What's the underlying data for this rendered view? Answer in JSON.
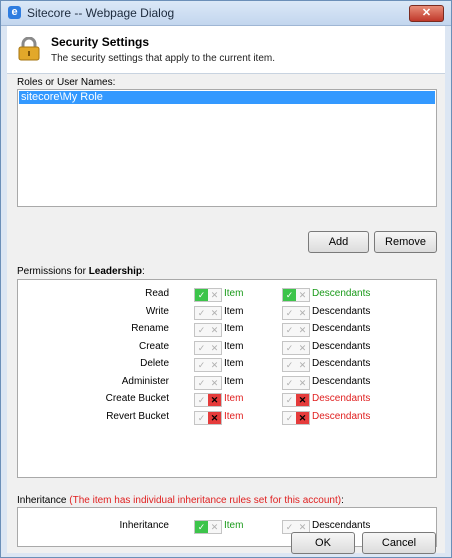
{
  "window": {
    "title": "Sitecore -- Webpage Dialog",
    "close_label": "✕"
  },
  "header": {
    "title": "Security Settings",
    "subtitle": "The security settings that apply to the current item."
  },
  "roles": {
    "label": "Roles or User Names:",
    "items": [
      "sitecore\\My Role"
    ],
    "add_label": "Add",
    "remove_label": "Remove"
  },
  "permissions": {
    "label_prefix": "Permissions for ",
    "target": "Leadership",
    "label_suffix": ":",
    "item_label": "Item",
    "descendants_label": "Descendants",
    "rows": [
      {
        "name": "Read",
        "item": "allow",
        "descendants": "allow"
      },
      {
        "name": "Write",
        "item": "none",
        "descendants": "none"
      },
      {
        "name": "Rename",
        "item": "none",
        "descendants": "none"
      },
      {
        "name": "Create",
        "item": "none",
        "descendants": "none"
      },
      {
        "name": "Delete",
        "item": "none",
        "descendants": "none"
      },
      {
        "name": "Administer",
        "item": "none",
        "descendants": "none"
      },
      {
        "name": "Create Bucket",
        "item": "deny",
        "descendants": "deny"
      },
      {
        "name": "Revert Bucket",
        "item": "deny",
        "descendants": "deny"
      }
    ]
  },
  "inheritance": {
    "label": "Inheritance ",
    "note": "(The item has individual inheritance rules set for this account)",
    "label_suffix": ":",
    "row": {
      "name": "Inheritance",
      "item": "allow",
      "descendants": "none"
    }
  },
  "footer": {
    "ok_label": "OK",
    "cancel_label": "Cancel"
  },
  "colors": {
    "allow": "#3cc44a",
    "deny": "#e53b3b",
    "selection": "#3399ff",
    "note": "#e02020"
  },
  "icons": {
    "check": "✓",
    "cross": "✕",
    "window": "internet-explorer-icon",
    "header": "lock-icon"
  }
}
